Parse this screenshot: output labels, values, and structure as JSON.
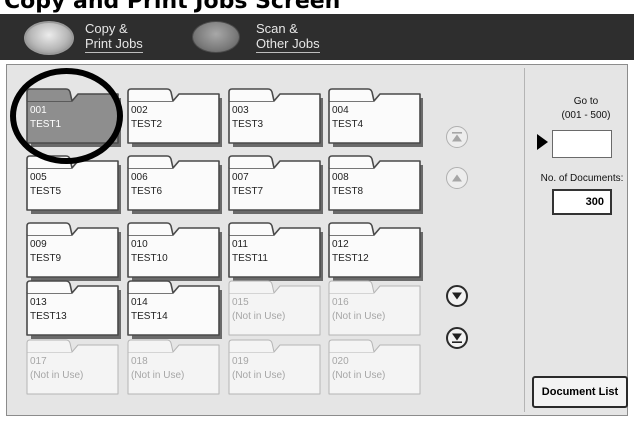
{
  "title": "Copy and Print Jobs Screen",
  "tabs": [
    {
      "line1": "Copy &",
      "line2": "Print Jobs"
    },
    {
      "line1": "Scan &",
      "line2": "Other Jobs"
    }
  ],
  "mailboxes": [
    {
      "number": "001",
      "name": "TEST1",
      "state": "selected"
    },
    {
      "number": "002",
      "name": "TEST2",
      "state": "used"
    },
    {
      "number": "003",
      "name": "TEST3",
      "state": "used"
    },
    {
      "number": "004",
      "name": "TEST4",
      "state": "used"
    },
    {
      "number": "005",
      "name": "TEST5",
      "state": "used"
    },
    {
      "number": "006",
      "name": "TEST6",
      "state": "used"
    },
    {
      "number": "007",
      "name": "TEST7",
      "state": "used"
    },
    {
      "number": "008",
      "name": "TEST8",
      "state": "used"
    },
    {
      "number": "009",
      "name": "TEST9",
      "state": "used"
    },
    {
      "number": "010",
      "name": "TEST10",
      "state": "used"
    },
    {
      "number": "011",
      "name": "TEST11",
      "state": "used"
    },
    {
      "number": "012",
      "name": "TEST12",
      "state": "used"
    },
    {
      "number": "013",
      "name": "TEST13",
      "state": "used"
    },
    {
      "number": "014",
      "name": "TEST14",
      "state": "used"
    },
    {
      "number": "015",
      "name": "(Not in Use)",
      "state": "empty"
    },
    {
      "number": "016",
      "name": "(Not in Use)",
      "state": "empty"
    },
    {
      "number": "017",
      "name": "(Not in Use)",
      "state": "empty"
    },
    {
      "number": "018",
      "name": "(Not in Use)",
      "state": "empty"
    },
    {
      "number": "019",
      "name": "(Not in Use)",
      "state": "empty"
    },
    {
      "number": "020",
      "name": "(Not in Use)",
      "state": "empty"
    }
  ],
  "goto": {
    "label": "Go to",
    "range": "(001 - 500)",
    "value": ""
  },
  "documents": {
    "label": "No. of Documents:",
    "count": "300"
  },
  "document_list_button": "Document List",
  "colors": {
    "selected_folder": "#8e8e8e",
    "highlight_circle": "#000000",
    "top_bar": "#2e2e2e"
  },
  "icons": [
    "scroll-top-icon",
    "scroll-up-icon",
    "scroll-down-icon",
    "scroll-bottom-icon",
    "go-to-arrow-icon"
  ]
}
